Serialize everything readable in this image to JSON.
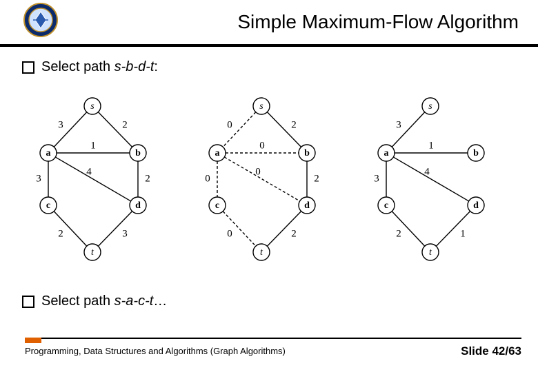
{
  "title": "Simple Maximum-Flow Algorithm",
  "bullet1_prefix": "Select path ",
  "bullet1_path": "s-b-d-t",
  "bullet1_suffix": ":",
  "bullet2_prefix": "Select path ",
  "bullet2_path": "s-a-c-t",
  "bullet2_suffix": "…",
  "footer_left": "Programming, Data Structures and Algorithms  (Graph Algorithms)",
  "footer_right": "Slide 42/63",
  "graphs": [
    {
      "nodes": {
        "s": "s",
        "a": "a",
        "b": "b",
        "c": "c",
        "d": "d",
        "t": "t"
      },
      "edges": [
        {
          "from": "s",
          "to": "a",
          "w": "3",
          "style": "solid"
        },
        {
          "from": "s",
          "to": "b",
          "w": "2",
          "style": "solid"
        },
        {
          "from": "a",
          "to": "b",
          "w": "1",
          "style": "solid"
        },
        {
          "from": "a",
          "to": "c",
          "w": "3",
          "style": "solid"
        },
        {
          "from": "b",
          "to": "d",
          "w": "2",
          "style": "solid"
        },
        {
          "from": "a",
          "to": "d",
          "w": "4",
          "style": "solid"
        },
        {
          "from": "c",
          "to": "t",
          "w": "2",
          "style": "solid"
        },
        {
          "from": "d",
          "to": "t",
          "w": "3",
          "style": "solid"
        }
      ]
    },
    {
      "nodes": {
        "s": "s",
        "a": "a",
        "b": "b",
        "c": "c",
        "d": "d",
        "t": "t"
      },
      "edges": [
        {
          "from": "s",
          "to": "a",
          "w": "0",
          "style": "dashed"
        },
        {
          "from": "s",
          "to": "b",
          "w": "2",
          "style": "solid"
        },
        {
          "from": "a",
          "to": "b",
          "w": "0",
          "style": "dashed"
        },
        {
          "from": "a",
          "to": "c",
          "w": "0",
          "style": "dashed"
        },
        {
          "from": "b",
          "to": "d",
          "w": "2",
          "style": "solid"
        },
        {
          "from": "a",
          "to": "d",
          "w": "0",
          "style": "dashed"
        },
        {
          "from": "c",
          "to": "t",
          "w": "0",
          "style": "dashed"
        },
        {
          "from": "d",
          "to": "t",
          "w": "2",
          "style": "solid"
        }
      ]
    },
    {
      "nodes": {
        "s": "s",
        "a": "a",
        "b": "b",
        "c": "c",
        "d": "d",
        "t": "t"
      },
      "edges": [
        {
          "from": "s",
          "to": "a",
          "w": "3",
          "style": "solid"
        },
        {
          "from": "a",
          "to": "b",
          "w": "1",
          "style": "solid"
        },
        {
          "from": "a",
          "to": "c",
          "w": "3",
          "style": "solid"
        },
        {
          "from": "a",
          "to": "d",
          "w": "4",
          "style": "solid"
        },
        {
          "from": "c",
          "to": "t",
          "w": "2",
          "style": "solid"
        },
        {
          "from": "d",
          "to": "t",
          "w": "1",
          "style": "solid"
        },
        {
          "from": "b",
          "to": "void",
          "w": "",
          "style": "none"
        }
      ]
    }
  ]
}
